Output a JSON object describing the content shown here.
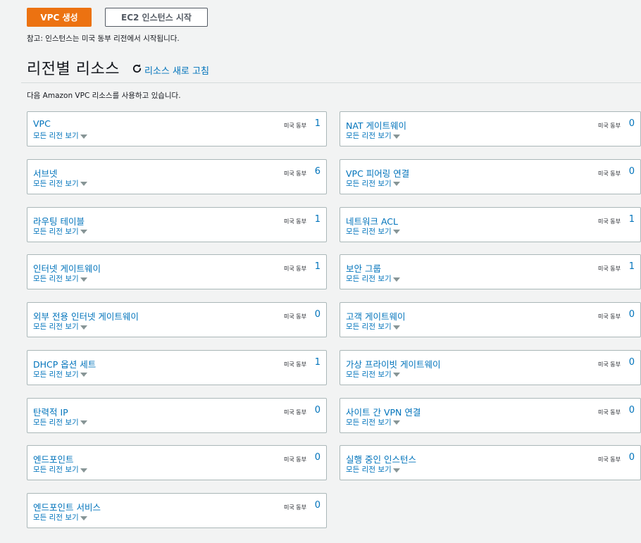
{
  "buttons": {
    "create_vpc": "VPC 생성",
    "launch_ec2": "EC2 인스턴스 시작"
  },
  "note": "참고: 인스턴스는 미국 동부 리전에서 시작됩니다.",
  "section": {
    "title": "리전별 리소스",
    "refresh_label": "리소스 새로 고침",
    "description": "다음 Amazon VPC 리소스를 사용하고 있습니다."
  },
  "colors": {
    "primary": "#ec7211",
    "link": "#0073bb",
    "border": "#aab7b8",
    "background": "#f2f3f3"
  },
  "resources": [
    {
      "name": "VPC",
      "sub": "모든 리전 보기",
      "region": "미국 동부",
      "count": "1"
    },
    {
      "name": "NAT 게이트웨이",
      "sub": "모든 리전 보기",
      "region": "미국 동부",
      "count": "0"
    },
    {
      "name": "서브넷",
      "sub": "모든 리전 보기",
      "region": "미국 동부",
      "count": "6"
    },
    {
      "name": "VPC 피어링 연결",
      "sub": "모든 리전 보기",
      "region": "미국 동부",
      "count": "0"
    },
    {
      "name": "라우팅 테이블",
      "sub": "모든 리전 보기",
      "region": "미국 동부",
      "count": "1"
    },
    {
      "name": "네트워크 ACL",
      "sub": "모든 리전 보기",
      "region": "미국 동부",
      "count": "1"
    },
    {
      "name": "인터넷 게이트웨이",
      "sub": "모든 리전 보기",
      "region": "미국 동부",
      "count": "1"
    },
    {
      "name": "보안 그룹",
      "sub": "모든 리전 보기",
      "region": "미국 동부",
      "count": "1"
    },
    {
      "name": "외부 전용 인터넷 게이트웨이",
      "sub": "모든 리전 보기",
      "region": "미국 동부",
      "count": "0"
    },
    {
      "name": "고객 게이트웨이",
      "sub": "모든 리전 보기",
      "region": "미국 동부",
      "count": "0"
    },
    {
      "name": "DHCP 옵션 세트",
      "sub": "모든 리전 보기",
      "region": "미국 동부",
      "count": "1"
    },
    {
      "name": "가상 프라이빗 게이트웨이",
      "sub": "모든 리전 보기",
      "region": "미국 동부",
      "count": "0"
    },
    {
      "name": "탄력적 IP",
      "sub": "모든 리전 보기",
      "region": "미국 동부",
      "count": "0"
    },
    {
      "name": "사이트 간 VPN 연결",
      "sub": "모든 리전 보기",
      "region": "미국 동부",
      "count": "0"
    },
    {
      "name": "엔드포인트",
      "sub": "모든 리전 보기",
      "region": "미국 동부",
      "count": "0"
    },
    {
      "name": "실행 중인 인스턴스",
      "sub": "모든 리전 보기",
      "region": "미국 동부",
      "count": "0"
    },
    {
      "name": "엔드포인트 서비스",
      "sub": "모든 리전 보기",
      "region": "미국 동부",
      "count": "0"
    }
  ]
}
